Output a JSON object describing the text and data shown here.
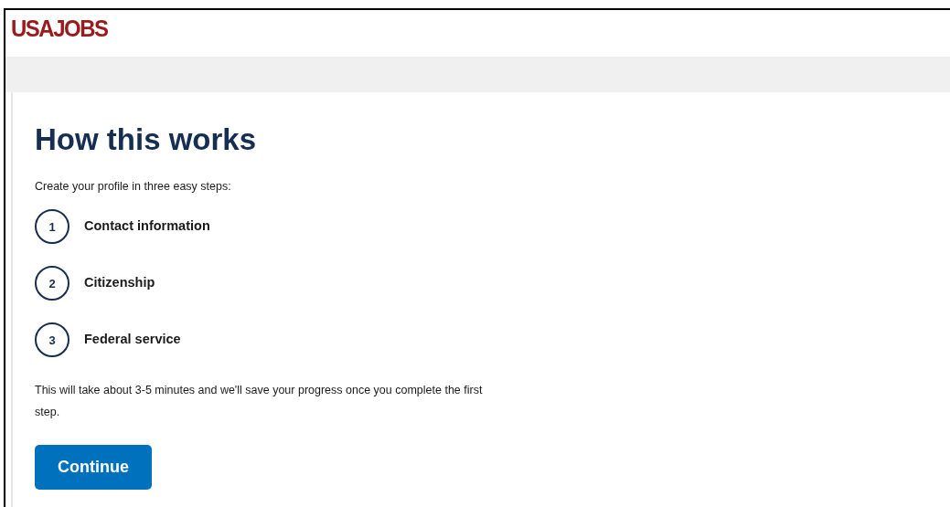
{
  "header": {
    "logo": "USAJOBS"
  },
  "main": {
    "title": "How this works",
    "intro": "Create your profile in three easy steps:",
    "steps": [
      {
        "number": "1",
        "label": "Contact information"
      },
      {
        "number": "2",
        "label": "Citizenship"
      },
      {
        "number": "3",
        "label": "Federal service"
      }
    ],
    "note": "This will take about 3-5 minutes and we'll save your progress once you complete the first step.",
    "button": "Continue"
  }
}
